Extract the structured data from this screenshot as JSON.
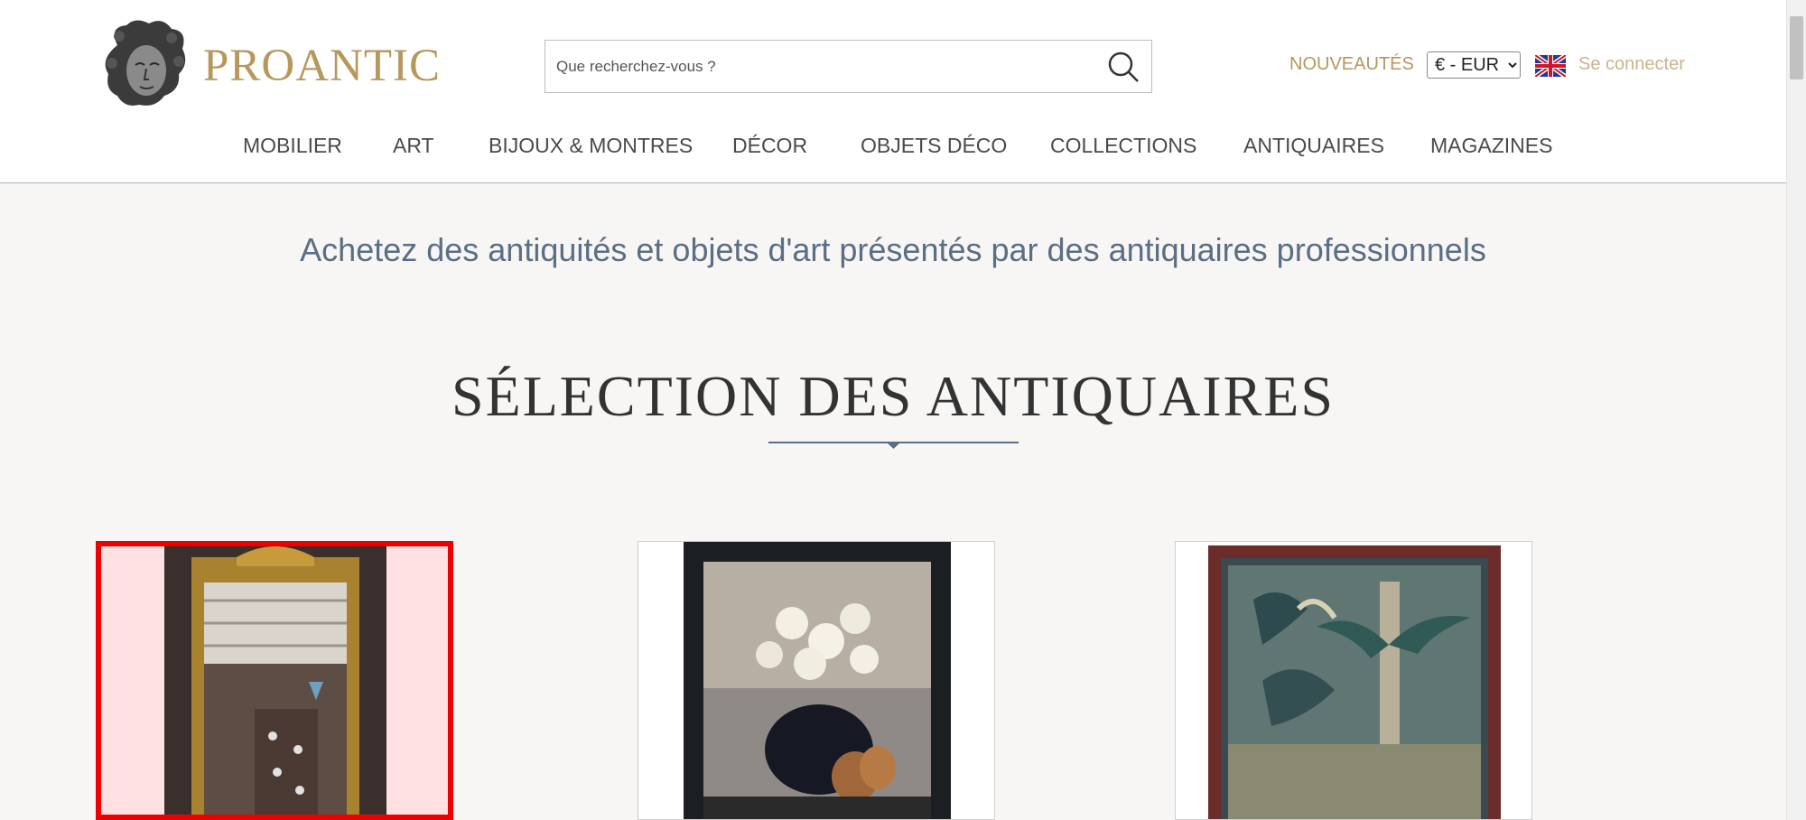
{
  "header": {
    "logo_text": "PROANTIC",
    "search": {
      "placeholder": "Que recherchez-vous ?",
      "value": ""
    },
    "new_label": "NOUVEAUTÉS",
    "currency": "€ - EUR",
    "login_label": "Se connecter"
  },
  "nav": {
    "items": [
      "MOBILIER",
      "ART",
      "BIJOUX & MONTRES",
      "DÉCOR",
      "OBJETS DÉCO",
      "COLLECTIONS",
      "ANTIQUAIRES",
      "MAGAZINES"
    ]
  },
  "main": {
    "tagline": "Achetez des antiquités et objets d'art présentés par des antiquaires professionnels",
    "section_title": "SÉLECTION DES ANTIQUAIRES"
  },
  "icons": {
    "logo": "cherub-head-logo",
    "search": "search-icon",
    "language": "uk-flag-icon",
    "divider": "diamond-divider"
  },
  "colors": {
    "brand_gold": "#b6975c",
    "login_gold": "#c9b48a",
    "tagline_blue": "#5a6e85",
    "selection_red": "#ee0000",
    "background": "#f7f6f4"
  }
}
